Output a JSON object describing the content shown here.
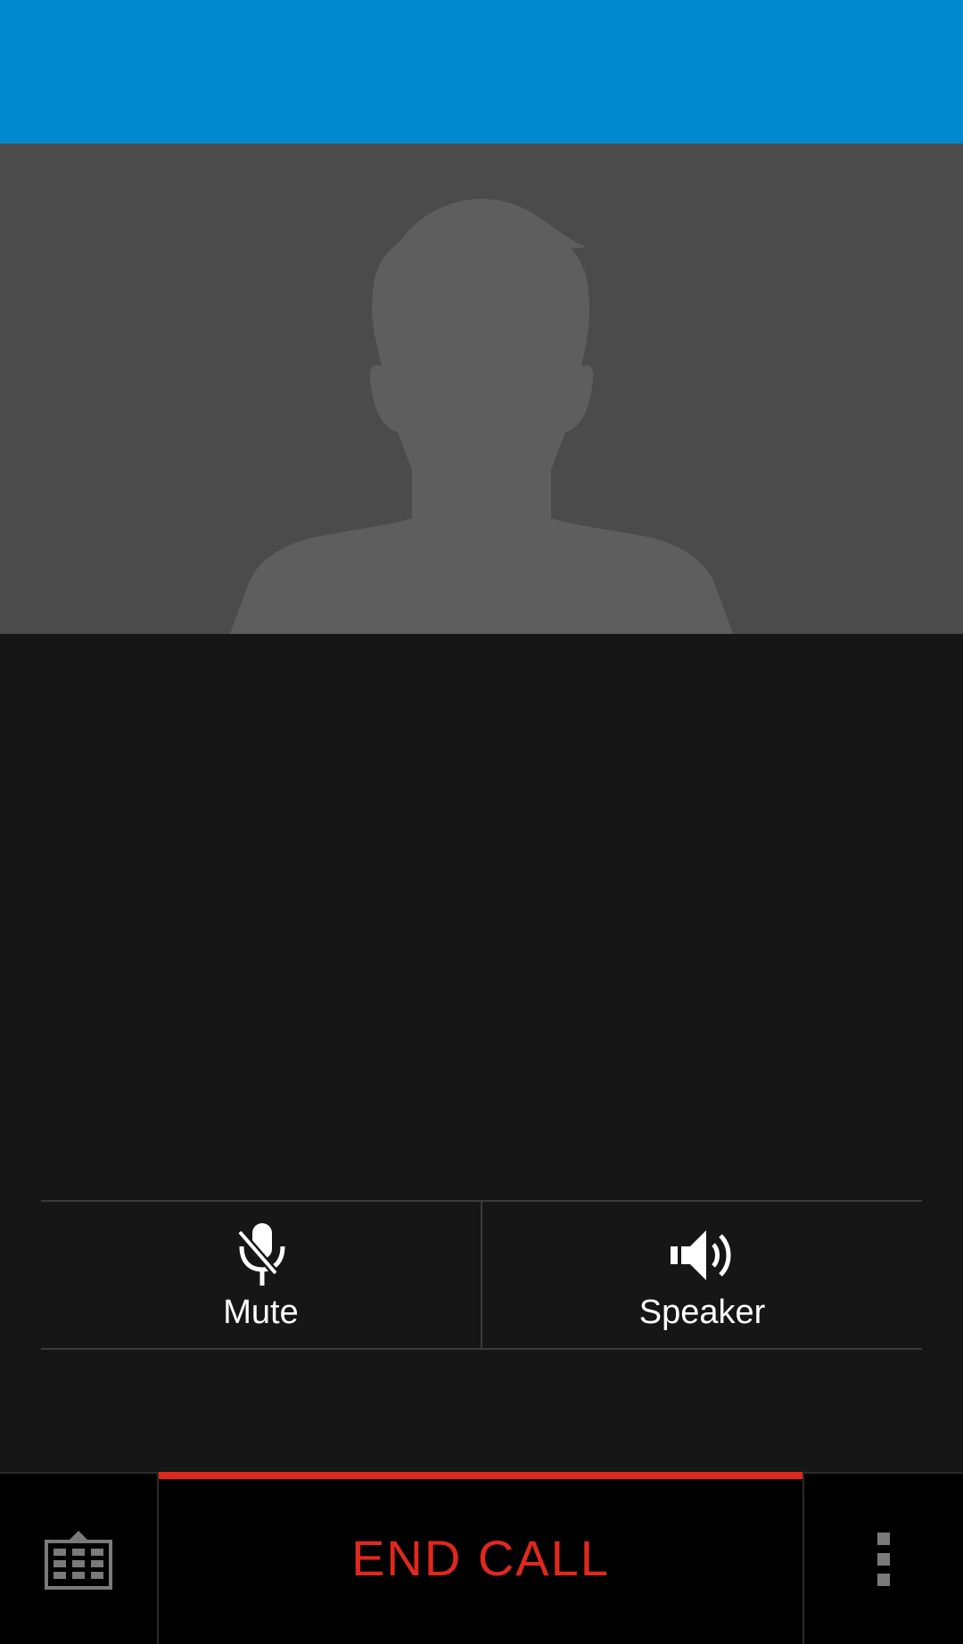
{
  "colors": {
    "top_bar": "#0288CC",
    "photo_bg": "#4B4B4B",
    "silhouette": "#5E5E5E",
    "background": "#161616",
    "end_call": "#E0281C",
    "icon_gray": "#7A7A7A"
  },
  "contact": {
    "avatar_icon": "person-silhouette-icon"
  },
  "controls": {
    "mute": {
      "label": "Mute",
      "icon": "mic-off-icon"
    },
    "speaker": {
      "label": "Speaker",
      "icon": "speaker-icon"
    }
  },
  "bottom_bar": {
    "dialpad_icon": "dialpad-icon",
    "end_call_label": "END CALL",
    "overflow_icon": "more-vert-icon"
  }
}
